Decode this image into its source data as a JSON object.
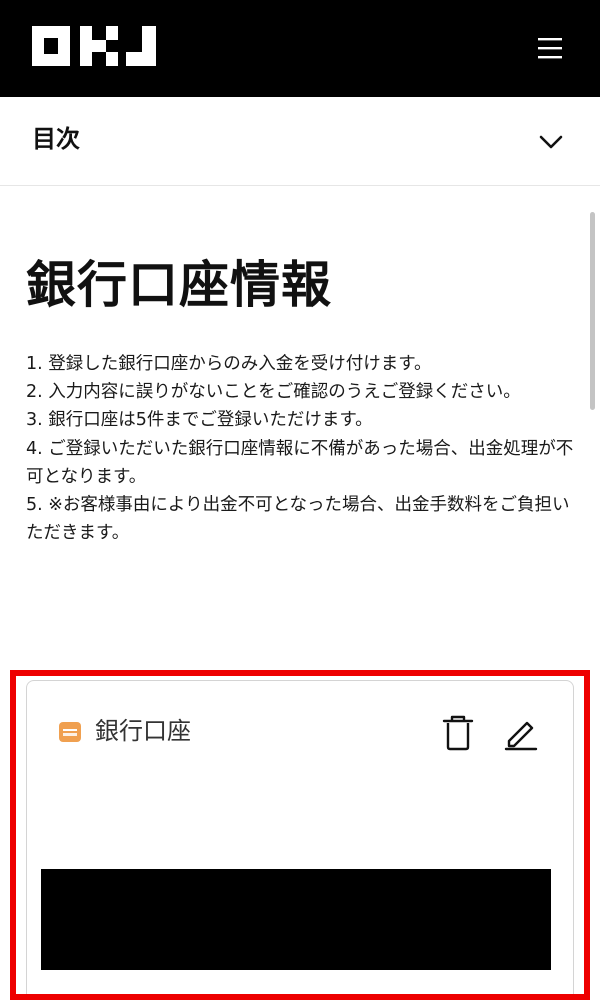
{
  "header": {
    "logo_icon": "okj-logo",
    "menu_icon": "hamburger-menu-icon"
  },
  "toc": {
    "label": "目次",
    "icon": "chevron-down-icon"
  },
  "page_title": "銀行口座情報",
  "notes": [
    "1. 登録した銀行口座からのみ入金を受け付けます。",
    "2. 入力内容に誤りがないことをご確認のうえご登録ください。",
    "3. 銀行口座は5件までご登録いただけます。",
    "4. ご登録いただいた銀行口座情報に不備があった場合、出金処理が不可となります。",
    "5. ※お客様事由により出金不可となった場合、出金手数料をご負担いただきます。"
  ],
  "card": {
    "title": "銀行口座",
    "icon": "bank-card-icon",
    "delete_icon": "trash-icon",
    "edit_icon": "pencil-icon"
  },
  "colors": {
    "header_bg": "#000000",
    "accent_orange": "#f0a050",
    "highlight_red": "#ee0000"
  }
}
